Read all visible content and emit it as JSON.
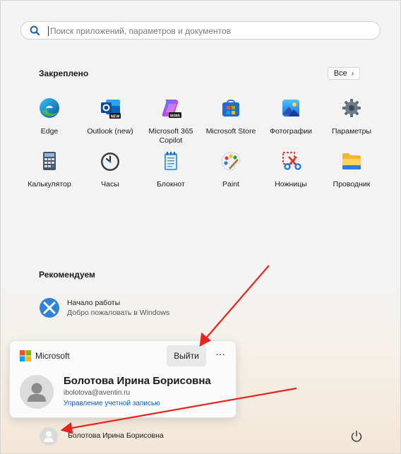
{
  "search": {
    "placeholder": "Поиск приложений, параметров и документов"
  },
  "pinned": {
    "title": "Закреплено",
    "all_label": "Все",
    "apps": [
      {
        "label": "Edge",
        "icon": "edge-icon"
      },
      {
        "label": "Outlook (new)",
        "icon": "outlook-icon",
        "badge": "NEW"
      },
      {
        "label": "Microsoft 365 Copilot",
        "icon": "copilot-icon",
        "badge": "M365"
      },
      {
        "label": "Microsoft Store",
        "icon": "store-icon"
      },
      {
        "label": "Фотографии",
        "icon": "photos-icon"
      },
      {
        "label": "Параметры",
        "icon": "settings-icon"
      },
      {
        "label": "Калькулятор",
        "icon": "calculator-icon"
      },
      {
        "label": "Часы",
        "icon": "clock-icon"
      },
      {
        "label": "Блокнот",
        "icon": "notepad-icon"
      },
      {
        "label": "Paint",
        "icon": "paint-icon"
      },
      {
        "label": "Ножницы",
        "icon": "scissors-icon"
      },
      {
        "label": "Проводник",
        "icon": "explorer-icon"
      }
    ]
  },
  "recommended": {
    "title": "Рекомендуем",
    "items": [
      {
        "title": "Начало работы",
        "subtitle": "Добро пожаловать в Windows",
        "icon": "get-started-icon"
      }
    ]
  },
  "account_card": {
    "brand": "Microsoft",
    "sign_out_label": "Выйти",
    "more_label": "···",
    "user_name": "Болотова Ирина Борисовна",
    "email": "ibolotova@aventin.ru",
    "manage_label": "Управление учетной записью"
  },
  "footer": {
    "user_name": "Болотова Ирина Борисовна",
    "power_icon": "power-icon"
  },
  "colors": {
    "accent": "#0f5bbd",
    "annotation_arrow": "#e8241e"
  }
}
